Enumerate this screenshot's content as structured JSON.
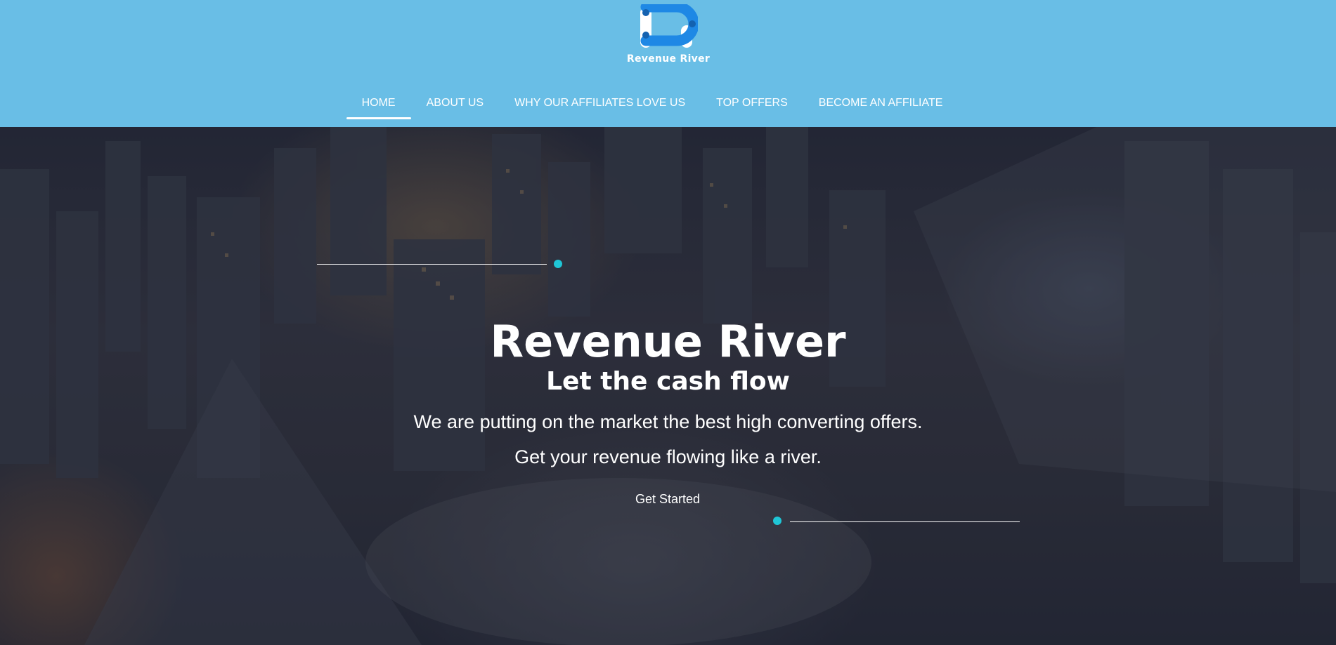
{
  "brand": {
    "name": "Revenue River",
    "logo_color": "#1e88e5"
  },
  "nav": {
    "items": [
      {
        "label": "HOME",
        "active": true
      },
      {
        "label": "ABOUT US",
        "active": false
      },
      {
        "label": "WHY OUR AFFILIATES LOVE US",
        "active": false
      },
      {
        "label": "TOP OFFERS",
        "active": false
      },
      {
        "label": "BECOME AN AFFILIATE",
        "active": false
      }
    ]
  },
  "hero": {
    "title": "Revenue River",
    "subtitle": "Let the cash flow",
    "line1": "We are putting on the market the best high converting offers.",
    "line2": "Get your revenue flowing like a river.",
    "cta_label": "Get Started"
  },
  "colors": {
    "header_bg": "#69bee6",
    "accent_dot": "#1fc6d6",
    "text": "#ffffff"
  }
}
